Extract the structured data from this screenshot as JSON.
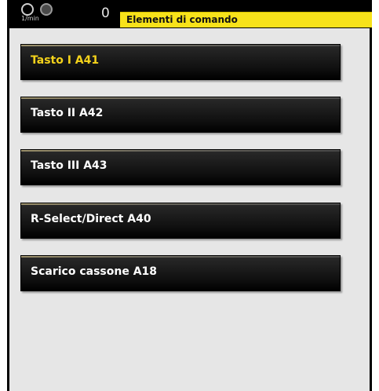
{
  "header": {
    "rpm_unit": "1/min",
    "rpm_value": "0",
    "title": "Elementi di comando"
  },
  "menu": {
    "items": [
      {
        "label": "Tasto I A41",
        "active": true
      },
      {
        "label": "Tasto II A42",
        "active": false
      },
      {
        "label": "Tasto III A43",
        "active": false
      },
      {
        "label": "R-Select/Direct A40",
        "active": false
      },
      {
        "label": "Scarico cassone A18",
        "active": false
      }
    ]
  },
  "colors": {
    "title_bar": "#f7e21a",
    "active_text": "#f4d21b",
    "button_text": "#ffffff",
    "background": "#e6e6e6"
  }
}
